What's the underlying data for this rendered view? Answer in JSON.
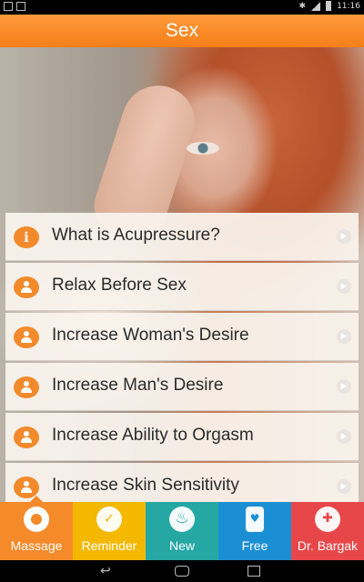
{
  "status_bar": {
    "time": "11:16"
  },
  "header": {
    "title": "Sex"
  },
  "menu": {
    "items": [
      {
        "label": "What is Acupressure?",
        "icon": "info-icon"
      },
      {
        "label": "Relax Before Sex",
        "icon": "person-icon"
      },
      {
        "label": "Increase Woman's Desire",
        "icon": "person-icon"
      },
      {
        "label": "Increase Man's Desire",
        "icon": "person-icon"
      },
      {
        "label": "Increase Ability to Orgasm",
        "icon": "person-icon"
      },
      {
        "label": "Increase Skin Sensitivity",
        "icon": "person-icon"
      }
    ]
  },
  "tabs": {
    "selected": "Massage",
    "items": [
      {
        "label": "Massage",
        "icon": "target-icon",
        "color": "#f58a2a"
      },
      {
        "label": "Reminder",
        "icon": "check-badge-icon",
        "color": "#f4b800"
      },
      {
        "label": "New",
        "icon": "flame-icon",
        "color": "#25a7a4"
      },
      {
        "label": "Free",
        "icon": "phone-heart-icon",
        "color": "#1b8fd3"
      },
      {
        "label": "Dr. Bargak",
        "icon": "doctor-icon",
        "color": "#e8474a"
      }
    ]
  },
  "info_glyph": "i"
}
